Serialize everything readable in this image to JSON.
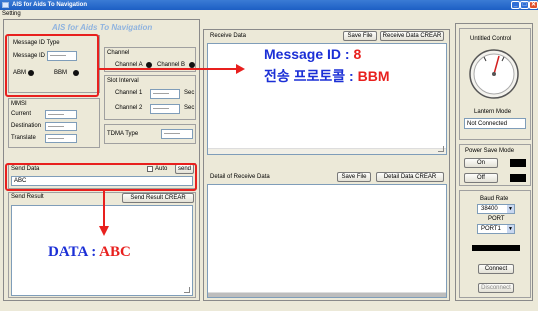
{
  "window": {
    "title": "AIS for Aids To Navigation",
    "controls": [
      "_",
      "□",
      "✕"
    ]
  },
  "menu": {
    "items": [
      "Setting"
    ]
  },
  "left": {
    "heading": "AIS for Aids To Navigation",
    "message_id_type": {
      "title": "Message ID Type",
      "message_id_label": "Message ID",
      "message_id_value": "--------",
      "abm_label": "ABM",
      "bbm_label": "BBM"
    },
    "channel": {
      "title": "Channel",
      "channel_a_label": "Channel A",
      "channel_b_label": "Channel B"
    },
    "mmsi": {
      "title": "MMSI",
      "current_label": "Current",
      "current_value": "--------",
      "destination_label": "Destination",
      "destination_value": "--------",
      "translate_label": "Translate",
      "translate_value": "--------"
    },
    "slot_interval": {
      "title": "Slot Interval",
      "channel1_label": "Channel 1",
      "channel1_value": "--------",
      "channel1_unit": "Sec",
      "channel2_label": "Channel 2",
      "channel2_value": "--------",
      "channel2_unit": "Sec"
    },
    "tdma": {
      "label": "TDMA Type",
      "value": "--------"
    },
    "send_data": {
      "title": "Send Data",
      "auto_label": "Auto",
      "send_button": "send",
      "value": "ABC"
    },
    "send_result": {
      "title": "Send Result",
      "clear_button": "Send Result CREAR"
    }
  },
  "middle": {
    "receive": {
      "title": "Receive Data",
      "save_button": "Save File",
      "clear_button": "Receive Data CREAR"
    },
    "detail": {
      "title": "Detail of Receive Data",
      "save_button": "Save File",
      "clear_button": "Detail Data CREAR"
    }
  },
  "right": {
    "untitled_control": "Untitled Control",
    "lantern_mode": {
      "title": "Lantern Mode",
      "value": "Not Connected"
    },
    "power_save": {
      "title": "Power Save Mode",
      "on_label": "On",
      "off_label": "Off"
    },
    "baud": {
      "title": "Baud Rate",
      "baud_value": "38400",
      "port_label": "PORT",
      "port_value": "PORT1",
      "connect_button": "Connect",
      "disconnect_button": "Disconnect"
    }
  },
  "annotations": {
    "msg_line1_prefix": "Message ID : ",
    "msg_line1_value": "8",
    "msg_line2_prefix": "전송 프로토콜 : ",
    "msg_line2_value": "BBM",
    "data_prefix": "DATA : ",
    "data_value": "ABC"
  },
  "colors": {
    "annotation_red": "#e8201e",
    "annotation_blue": "#1b2fd6",
    "title_blue": "#1d5fc4"
  }
}
